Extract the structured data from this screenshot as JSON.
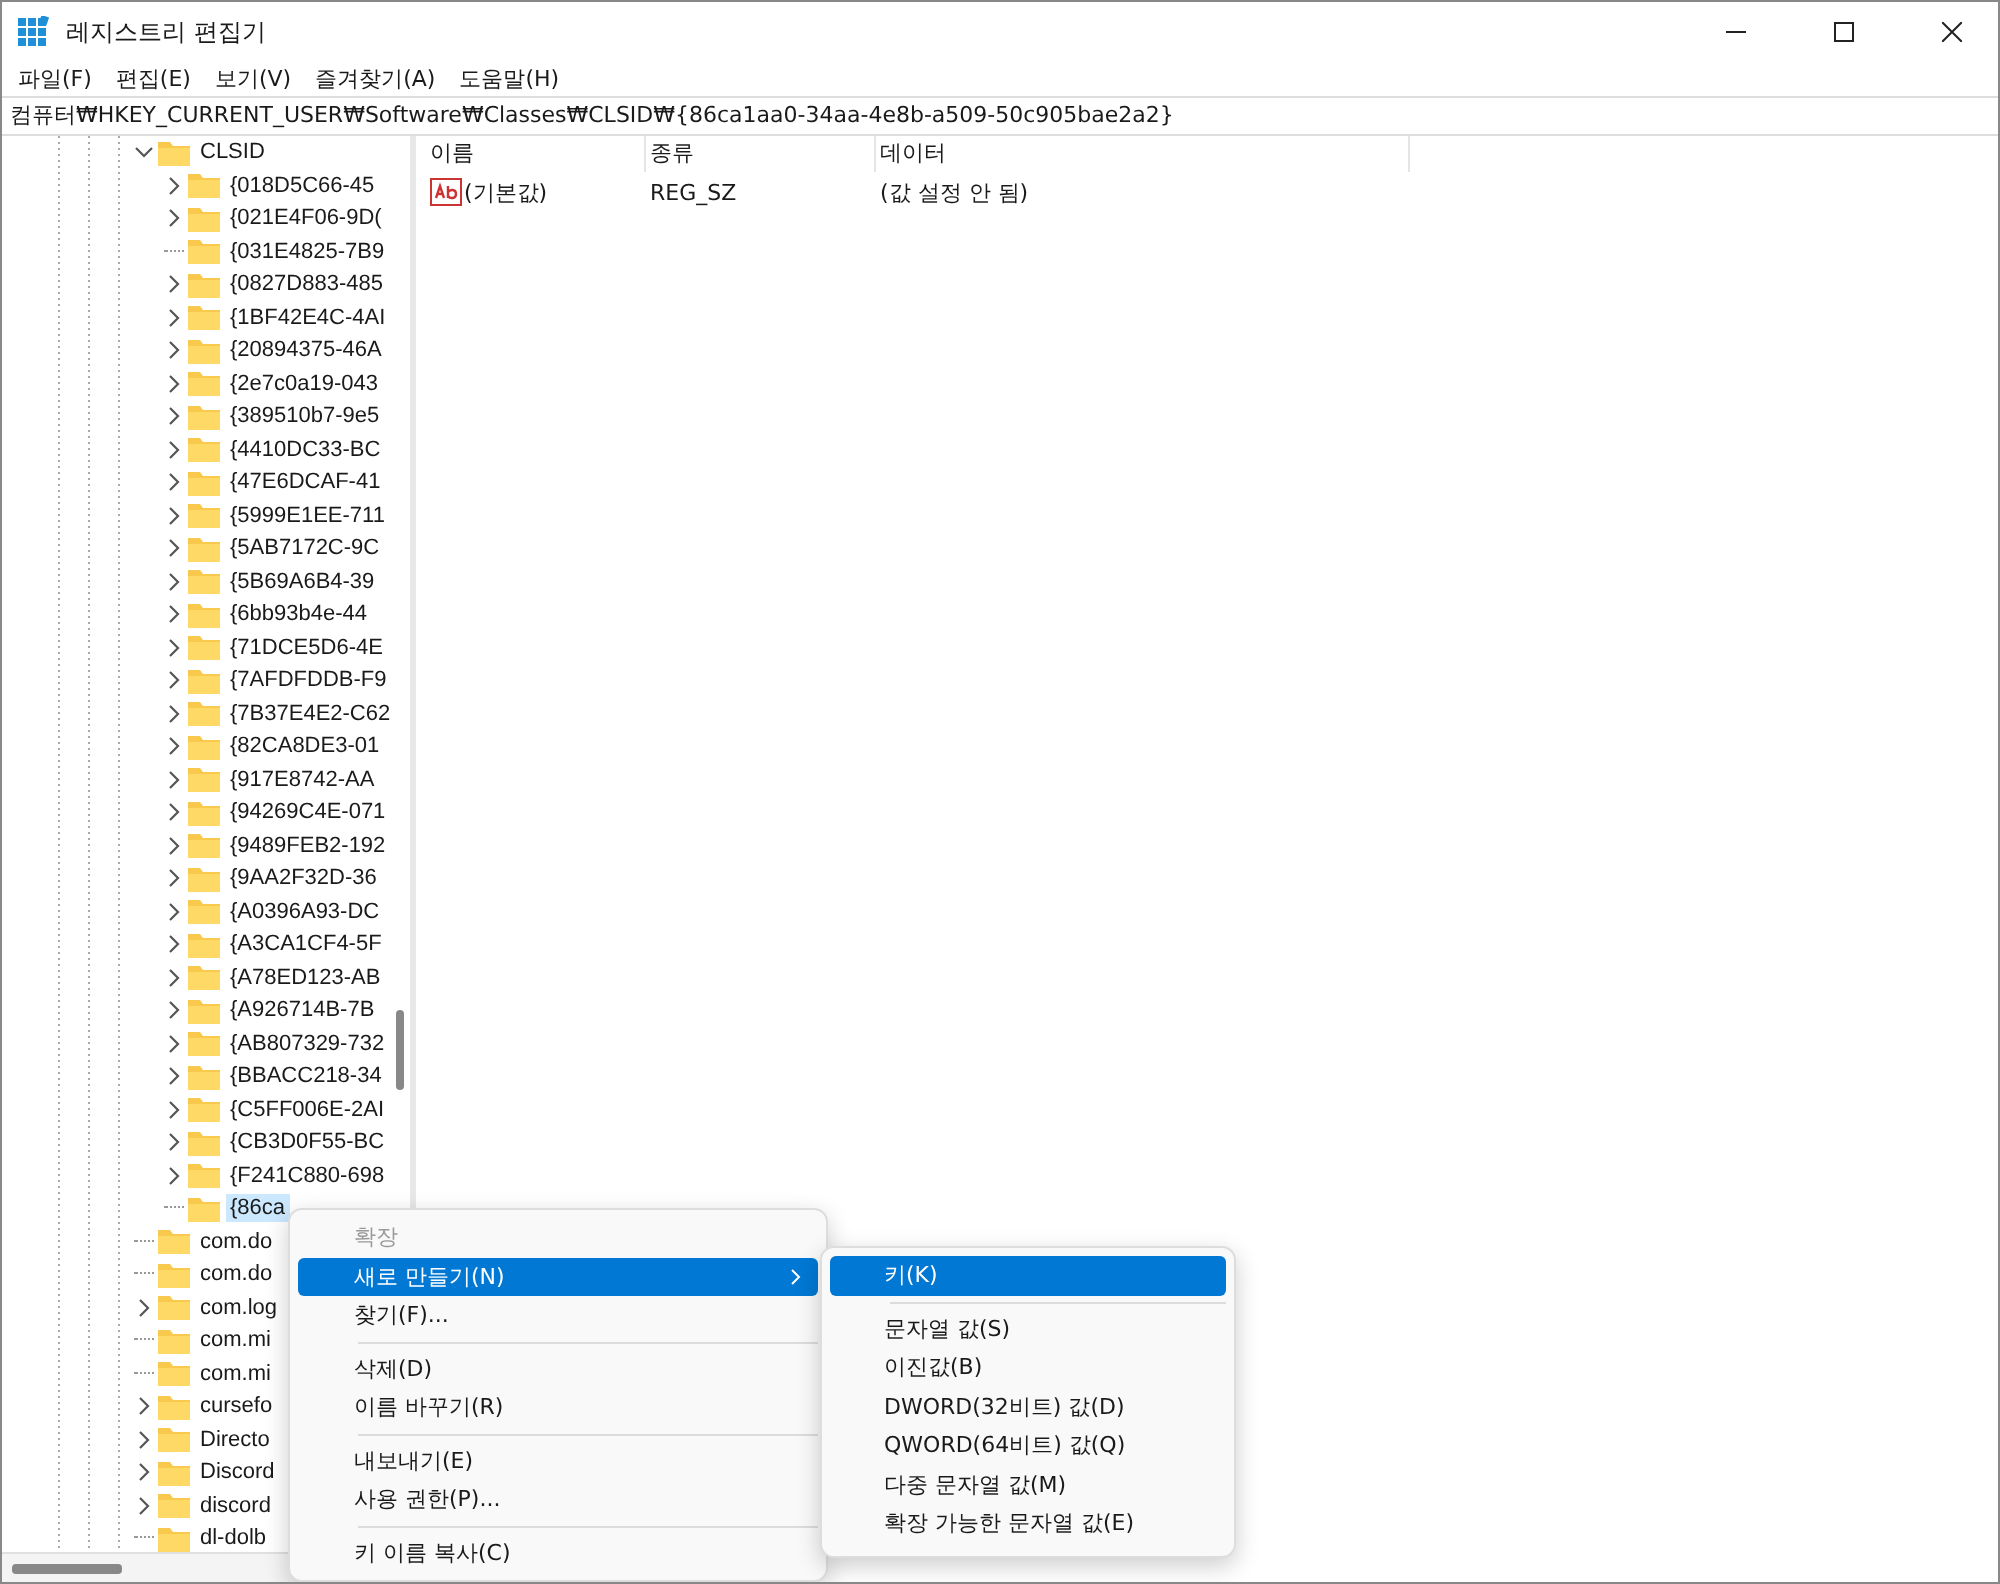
{
  "window": {
    "title": "레지스트리 편집기"
  },
  "menu_bar": [
    "파일(F)",
    "편집(E)",
    "보기(V)",
    "즐겨찾기(A)",
    "도움말(H)"
  ],
  "address": "컴퓨터₩HKEY_CURRENT_USER₩Software₩Classes₩CLSID₩{86ca1aa0-34aa-4e8b-a509-50c905bae2a2}",
  "tree": [
    {
      "label": "CLSID",
      "has_children": true,
      "selected": false,
      "children": [
        {
          "label": "{018D5C66-45",
          "has_children": true,
          "selected": false
        },
        {
          "label": "{021E4F06-9D(",
          "has_children": true,
          "selected": false
        },
        {
          "label": "{031E4825-7B9",
          "has_children": false,
          "selected": false
        },
        {
          "label": "{0827D883-485",
          "has_children": true,
          "selected": false
        },
        {
          "label": "{1BF42E4C-4AI",
          "has_children": true,
          "selected": false
        },
        {
          "label": "{20894375-46A",
          "has_children": true,
          "selected": false
        },
        {
          "label": "{2e7c0a19-043",
          "has_children": true,
          "selected": false
        },
        {
          "label": "{389510b7-9e5",
          "has_children": true,
          "selected": false
        },
        {
          "label": "{4410DC33-BC",
          "has_children": true,
          "selected": false
        },
        {
          "label": "{47E6DCAF-41",
          "has_children": true,
          "selected": false
        },
        {
          "label": "{5999E1EE-711",
          "has_children": true,
          "selected": false
        },
        {
          "label": "{5AB7172C-9C",
          "has_children": true,
          "selected": false
        },
        {
          "label": "{5B69A6B4-39",
          "has_children": true,
          "selected": false
        },
        {
          "label": "{6bb93b4e-44",
          "has_children": true,
          "selected": false
        },
        {
          "label": "{71DCE5D6-4E",
          "has_children": true,
          "selected": false
        },
        {
          "label": "{7AFDFDDB-F9",
          "has_children": true,
          "selected": false
        },
        {
          "label": "{7B37E4E2-C62",
          "has_children": true,
          "selected": false
        },
        {
          "label": "{82CA8DE3-01",
          "has_children": true,
          "selected": false
        },
        {
          "label": "{917E8742-AA",
          "has_children": true,
          "selected": false
        },
        {
          "label": "{94269C4E-071",
          "has_children": true,
          "selected": false
        },
        {
          "label": "{9489FEB2-192",
          "has_children": true,
          "selected": false
        },
        {
          "label": "{9AA2F32D-36",
          "has_children": true,
          "selected": false
        },
        {
          "label": "{A0396A93-DC",
          "has_children": true,
          "selected": false
        },
        {
          "label": "{A3CA1CF4-5F",
          "has_children": true,
          "selected": false
        },
        {
          "label": "{A78ED123-AB",
          "has_children": true,
          "selected": false
        },
        {
          "label": "{A926714B-7B",
          "has_children": true,
          "selected": false
        },
        {
          "label": "{AB807329-732",
          "has_children": true,
          "selected": false
        },
        {
          "label": "{BBACC218-34",
          "has_children": true,
          "selected": false
        },
        {
          "label": "{C5FF006E-2AI",
          "has_children": true,
          "selected": false
        },
        {
          "label": "{CB3D0F55-BC",
          "has_children": true,
          "selected": false
        },
        {
          "label": "{F241C880-698",
          "has_children": true,
          "selected": false
        },
        {
          "label": "{86ca",
          "has_children": false,
          "selected": true
        }
      ]
    },
    {
      "label": "com.do",
      "has_children": false,
      "selected": false
    },
    {
      "label": "com.do",
      "has_children": false,
      "selected": false
    },
    {
      "label": "com.log",
      "has_children": true,
      "selected": false
    },
    {
      "label": "com.mi",
      "has_children": false,
      "selected": false
    },
    {
      "label": "com.mi",
      "has_children": false,
      "selected": false
    },
    {
      "label": "cursefo",
      "has_children": true,
      "selected": false
    },
    {
      "label": "Directo",
      "has_children": true,
      "selected": false
    },
    {
      "label": "Discord",
      "has_children": true,
      "selected": false
    },
    {
      "label": "discord",
      "has_children": true,
      "selected": false
    },
    {
      "label": "dl-dolb",
      "has_children": false,
      "selected": false
    }
  ],
  "values": {
    "columns": [
      "이름",
      "종류",
      "데이터"
    ],
    "rows": [
      {
        "name": "(기본값)",
        "type": "REG_SZ",
        "data": "(값 설정 안 됨)"
      }
    ]
  },
  "context_menu": [
    {
      "kind": "item",
      "label": "확장",
      "disabled": true,
      "selected": false,
      "submenu": false
    },
    {
      "kind": "item",
      "label": "새로 만들기(N)",
      "disabled": false,
      "selected": true,
      "submenu": true
    },
    {
      "kind": "item",
      "label": "찾기(F)...",
      "disabled": false,
      "selected": false,
      "submenu": false
    },
    {
      "kind": "separator"
    },
    {
      "kind": "item",
      "label": "삭제(D)",
      "disabled": false,
      "selected": false,
      "submenu": false
    },
    {
      "kind": "item",
      "label": "이름 바꾸기(R)",
      "disabled": false,
      "selected": false,
      "submenu": false
    },
    {
      "kind": "separator"
    },
    {
      "kind": "item",
      "label": "내보내기(E)",
      "disabled": false,
      "selected": false,
      "submenu": false
    },
    {
      "kind": "item",
      "label": "사용 권한(P)...",
      "disabled": false,
      "selected": false,
      "submenu": false
    },
    {
      "kind": "separator"
    },
    {
      "kind": "item",
      "label": "키 이름 복사(C)",
      "disabled": false,
      "selected": false,
      "submenu": false
    }
  ],
  "submenu": [
    {
      "kind": "item",
      "label": "키(K)",
      "selected": true
    },
    {
      "kind": "separator"
    },
    {
      "kind": "item",
      "label": "문자열 값(S)",
      "selected": false
    },
    {
      "kind": "item",
      "label": "이진값(B)",
      "selected": false
    },
    {
      "kind": "item",
      "label": "DWORD(32비트) 값(D)",
      "selected": false
    },
    {
      "kind": "item",
      "label": "QWORD(64비트) 값(Q)",
      "selected": false
    },
    {
      "kind": "item",
      "label": "다중 문자열 값(M)",
      "selected": false
    },
    {
      "kind": "item",
      "label": "확장 가능한 문자열 값(E)",
      "selected": false
    }
  ]
}
